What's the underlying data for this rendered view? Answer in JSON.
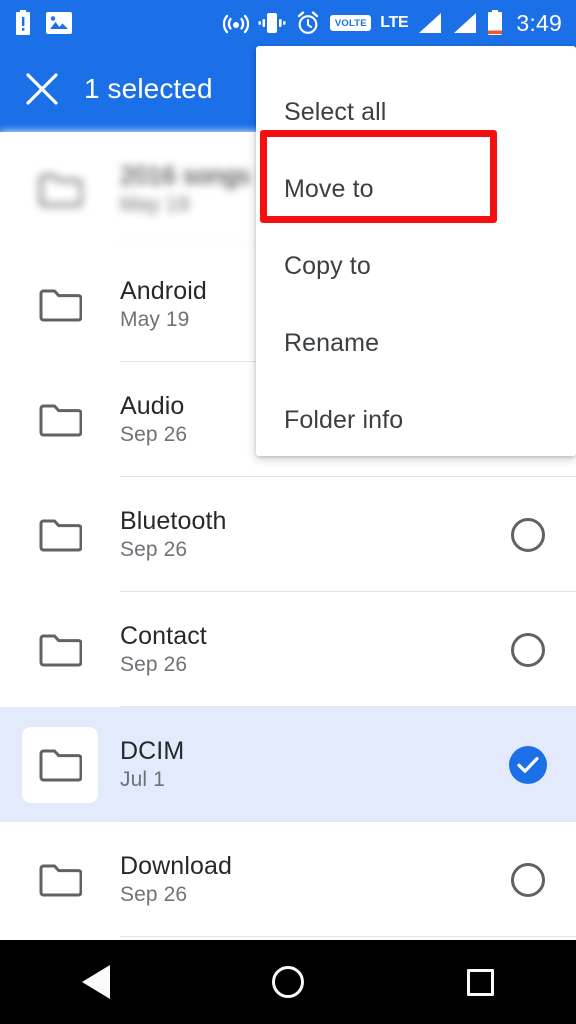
{
  "theme": {
    "accent_blue": "#1b70e8",
    "selected_row_bg": "#e3eafb",
    "highlight_red": "#f41010",
    "nav_bar_bg": "#000000",
    "primary_text": "#26282b",
    "secondary_text": "#6f7377"
  },
  "status_bar": {
    "left_icons": [
      "battery-alert-icon",
      "image-icon"
    ],
    "right_icons": [
      "hotspot-icon",
      "vibrate-icon",
      "alarm-icon"
    ],
    "volte_label": "VOLTE",
    "network_label": "LTE",
    "signal_icons": [
      "signal-bars-icon",
      "signal-bars-icon"
    ],
    "battery_icon": "battery-icon",
    "clock": "3:49"
  },
  "app_bar": {
    "close_icon": "close-icon",
    "title": "1 selected"
  },
  "menu": {
    "items": [
      {
        "label": "Select all"
      },
      {
        "label": "Move to"
      },
      {
        "label": "Copy to"
      },
      {
        "label": "Rename"
      },
      {
        "label": "Folder info"
      }
    ],
    "highlighted_index": 1
  },
  "file_list": {
    "rows": [
      {
        "name": "2016 songs",
        "date": "May 19",
        "selected": false,
        "blurred": true,
        "trailing": "none"
      },
      {
        "name": "Android",
        "date": "May 19",
        "selected": false,
        "blurred": false,
        "trailing": "circle"
      },
      {
        "name": "Audio",
        "date": "Sep 26",
        "selected": false,
        "blurred": false,
        "trailing": "circle"
      },
      {
        "name": "Bluetooth",
        "date": "Sep 26",
        "selected": false,
        "blurred": false,
        "trailing": "circle"
      },
      {
        "name": "Contact",
        "date": "Sep 26",
        "selected": false,
        "blurred": false,
        "trailing": "circle"
      },
      {
        "name": "DCIM",
        "date": "Jul 1",
        "selected": true,
        "blurred": false,
        "trailing": "check"
      },
      {
        "name": "Download",
        "date": "Sep 26",
        "selected": false,
        "blurred": false,
        "trailing": "circle"
      }
    ]
  },
  "nav_bar": {
    "back_icon": "back-triangle-icon",
    "home_icon": "home-circle-icon",
    "recents_icon": "recents-square-icon"
  }
}
